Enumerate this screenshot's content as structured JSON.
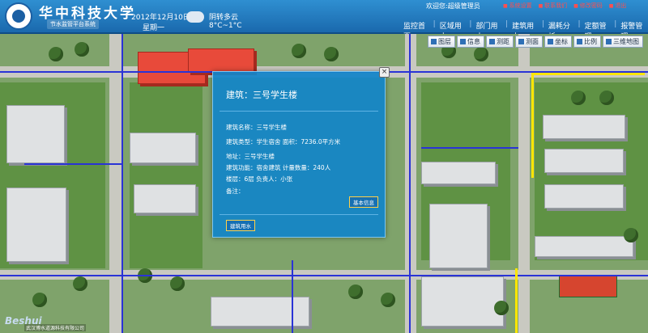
{
  "header": {
    "university": "华中科技大学",
    "system": "节水监管平台系统",
    "date": "2012年12月10日",
    "weekday": "星期一",
    "weather": "阴转多云",
    "temperature": "8°C~1°C",
    "welcome": "欢迎您:超级管理员",
    "links": [
      "系统设置",
      "联系我们",
      "修改密码",
      "退出"
    ],
    "nav": [
      "监控首页",
      "区域用水",
      "部门用水",
      "建筑用水",
      "漏耗分析",
      "定额管理",
      "报警管理"
    ]
  },
  "toolbar": [
    "图层",
    "信息",
    "测距",
    "测面",
    "坐标",
    "比例",
    "三维地图"
  ],
  "popup": {
    "title": "建筑：三号学生楼",
    "name": "建筑名称：三号学生楼",
    "type_area": "建筑类型：学生宿舍  面积：7236.0平方米",
    "address": "地址：三号学生楼",
    "function": "建筑功能：宿舍建筑  计量数量：240人",
    "floors": "楼层：6层  负责人：小张",
    "remark": "备注：",
    "basic_info_btn": "基本信息",
    "water_btn": "建筑用水"
  },
  "brand": "Beshui",
  "copyright": "武汉博水道源科技有限公司"
}
